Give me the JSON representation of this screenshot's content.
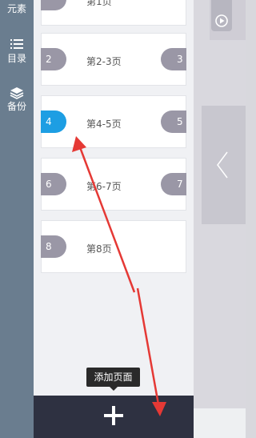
{
  "sidebar": {
    "items": [
      {
        "label": "元素",
        "icon": "shapes-icon"
      },
      {
        "label": "目录",
        "icon": "list-icon"
      },
      {
        "label": "备份",
        "icon": "layers-icon"
      }
    ]
  },
  "pages": [
    {
      "label": "第1页",
      "left_tab": "",
      "right_tab": ""
    },
    {
      "label": "第2-3页",
      "left_tab": "2",
      "right_tab": "3"
    },
    {
      "label": "第4-5页",
      "left_tab": "4",
      "right_tab": "5",
      "active_left": true
    },
    {
      "label": "第6-7页",
      "left_tab": "6",
      "right_tab": "7"
    },
    {
      "label": "第8页",
      "left_tab": "8",
      "right_tab": ""
    }
  ],
  "add_page": {
    "tooltip": "添加页面",
    "icon": "plus-icon"
  },
  "colors": {
    "accent": "#1d9ee3",
    "annotation": "#e53935",
    "rail": "#6a7d8f",
    "bottom_bar": "#2e3141"
  }
}
